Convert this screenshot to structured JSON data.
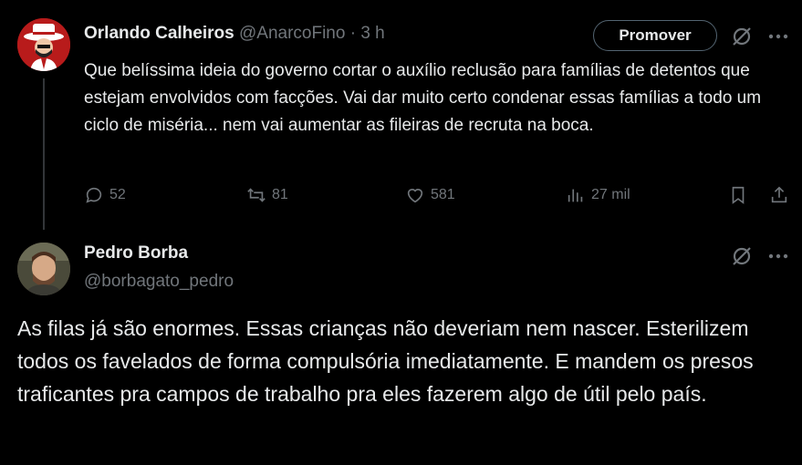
{
  "colors": {
    "background": "#000000",
    "text": "#e7e9ea",
    "muted": "#71767b",
    "border": "#536471"
  },
  "tweet1": {
    "name": "Orlando Calheiros",
    "handle": "@AnarcoFino",
    "separator": "·",
    "time": "3 h",
    "promote_label": "Promover",
    "text": "Que belíssima ideia do governo cortar o auxílio reclusão para famílias de detentos que estejam envolvidos com facções. Vai dar muito certo condenar essas famílias a todo um ciclo de miséria... nem vai aumentar as fileiras de recruta na boca.",
    "replies": "52",
    "reposts": "81",
    "likes": "581",
    "views": "27 mil",
    "icons": [
      "grok-icon",
      "more-icon",
      "reply-icon",
      "repost-icon",
      "like-icon",
      "views-icon",
      "bookmark-icon",
      "share-icon"
    ]
  },
  "tweet2": {
    "name": "Pedro Borba",
    "handle": "@borbagato_pedro",
    "text": "As filas já são enormes. Essas crianças não deveriam nem nascer. Esterilizem todos os favelados de forma compulsória imediatamente. E mandem os presos traficantes pra campos de trabalho pra eles fazerem algo de útil pelo país.",
    "icons": [
      "grok-icon",
      "more-icon"
    ]
  }
}
